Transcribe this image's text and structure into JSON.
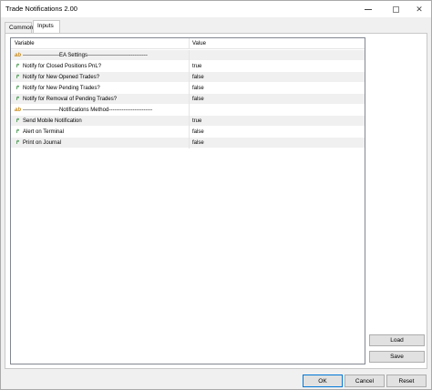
{
  "window": {
    "title": "Trade Notifications 2.00"
  },
  "tabs": [
    {
      "label": "Common"
    },
    {
      "label": "Inputs"
    }
  ],
  "grid": {
    "headers": {
      "variable": "Variable",
      "value": "Value"
    },
    "rows": [
      {
        "icon": "ab-text-icon",
        "variable": "--------------------EA Settings---------------------------------",
        "value": ""
      },
      {
        "icon": "parameter-icon",
        "variable": "Notify for Closed Positions PnL?",
        "value": "true"
      },
      {
        "icon": "parameter-icon",
        "variable": "Notify for New Opened Trades?",
        "value": "false"
      },
      {
        "icon": "parameter-icon",
        "variable": "Notify for New Pending Trades?",
        "value": "false"
      },
      {
        "icon": "parameter-icon",
        "variable": "Notify for Removal of Pending Trades?",
        "value": "false"
      },
      {
        "icon": "ab-text-icon",
        "variable": "--------------------Notifications Method------------------------",
        "value": ""
      },
      {
        "icon": "parameter-icon",
        "variable": "Send Mobile Notification",
        "value": "true"
      },
      {
        "icon": "parameter-icon",
        "variable": "Alert on Terminal",
        "value": "false"
      },
      {
        "icon": "parameter-icon",
        "variable": "Print on Journal",
        "value": "false"
      }
    ]
  },
  "side_buttons": {
    "load": "Load",
    "save": "Save"
  },
  "bottom_buttons": {
    "ok": "OK",
    "cancel": "Cancel",
    "reset": "Reset"
  },
  "icons": {
    "ab_glyph": "ab",
    "param_glyph": "↱"
  }
}
